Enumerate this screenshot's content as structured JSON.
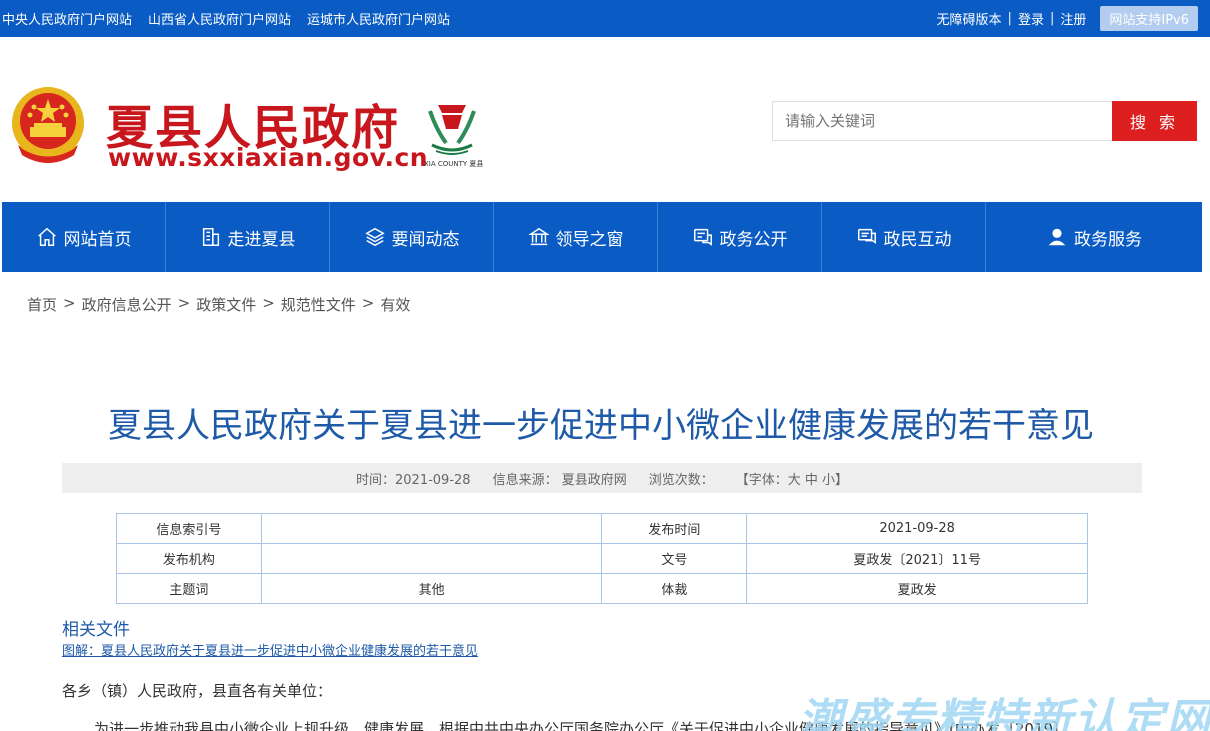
{
  "topbar": {
    "links": [
      "中央人民政府门户网站",
      "山西省人民政府门户网站",
      "运城市人民政府门户网站"
    ],
    "accessibility": "无障碍版本",
    "login": "登录",
    "register": "注册",
    "ipv6": "网站支持IPv6"
  },
  "header": {
    "site_name": "夏县人民政府",
    "site_url": "www.sxxiaxian.gov.cn",
    "county_logo_text": "XIA COUNTY 夏县",
    "search_placeholder": "请输入关键词",
    "search_button": "搜 索"
  },
  "nav": {
    "items": [
      {
        "label": "网站首页",
        "icon": "home-icon"
      },
      {
        "label": "走进夏县",
        "icon": "building-icon"
      },
      {
        "label": "要闻动态",
        "icon": "layers-icon"
      },
      {
        "label": "领导之窗",
        "icon": "institution-icon"
      },
      {
        "label": "政务公开",
        "icon": "document-chat-icon"
      },
      {
        "label": "政民互动",
        "icon": "message-icon"
      },
      {
        "label": "政务服务",
        "icon": "user-service-icon"
      }
    ]
  },
  "breadcrumb": [
    "首页",
    "政府信息公开",
    "政策文件",
    "规范性文件",
    "有效"
  ],
  "breadcrumb_sep": ">",
  "article": {
    "title": "夏县人民政府关于夏县进一步促进中小微企业健康发展的若干意见",
    "meta": {
      "time": "时间：2021-09-28",
      "source": "信息来源：  夏县政府网",
      "views": "浏览次数：",
      "font_size": "【字体：大 中 小】"
    },
    "info_table": [
      [
        "信息索引号",
        "",
        "发布时间",
        "2021-09-28"
      ],
      [
        "发布机构",
        "",
        "文号",
        "夏政发〔2021〕11号"
      ],
      [
        "主题词",
        "其他",
        "体裁",
        "夏政发"
      ]
    ],
    "related_title": "相关文件",
    "related_link": "图解：夏县人民政府关于夏县进一步促进中小微企业健康发展的若干意见",
    "greeting": "各乡（镇）人民政府，县直各有关单位：",
    "body_first_line": "为进一步推动我县中小微企业上规升级、健康发展，根据中共中央办公厅国务院办公厅《关于促进中小企业健康发展的指导意见》(中办发〔2019〕"
  },
  "watermark": "潮盛专精特新认定网",
  "colors": {
    "primary_blue": "#0a5cc4",
    "brand_red": "#c8161d",
    "search_red": "#de1f1f",
    "title_blue": "#1e5aa8"
  }
}
